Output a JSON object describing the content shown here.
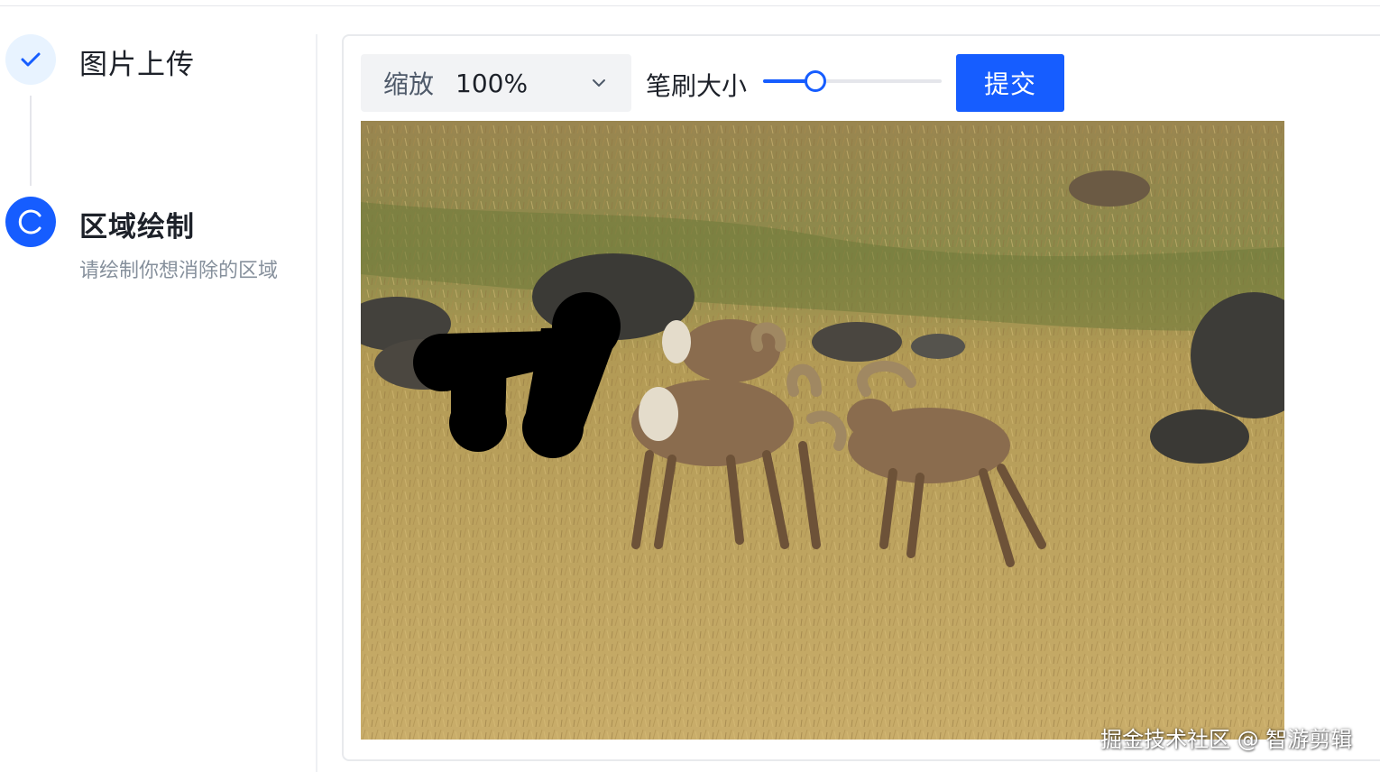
{
  "steps": {
    "step1": {
      "title": "图片上传",
      "status": "done"
    },
    "step2": {
      "title": "区域绘制",
      "description": "请绘制你想消除的区域",
      "status": "active"
    }
  },
  "toolbar": {
    "zoom_label": "缩放",
    "zoom_value": "100%",
    "brush_label": "笔刷大小",
    "brush_level": 0.29,
    "submit_label": "提交"
  },
  "watermark": "掘金技术社区 @ 智游剪辑",
  "colors": {
    "accent": "#165dff",
    "step_done_bg": "#e8f3ff",
    "select_bg": "#f2f3f5",
    "mask": "#000000"
  },
  "icons": {
    "step1": "check-icon",
    "step2": "loading-spinner-icon",
    "zoom": "chevron-down-icon"
  }
}
